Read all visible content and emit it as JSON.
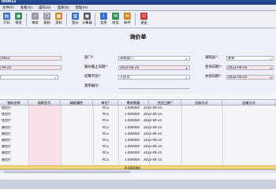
{
  "window": {
    "title": "000012"
  },
  "menu": [
    "文件(F)",
    "查看(V)",
    "操作(O)",
    "选择(S)",
    "帮助(H)"
  ],
  "toolbar": [
    {
      "label": "打印",
      "icon": "printer-icon",
      "color": "#3a6fc1",
      "glyph": "▤"
    },
    {
      "label": "预览",
      "icon": "preview-icon",
      "color": "#3a8f5a",
      "glyph": "◉"
    },
    {
      "label": "审核",
      "icon": "approve-icon",
      "color": "#9a9aa8",
      "glyph": "✓"
    },
    {
      "label": "复制",
      "icon": "copy-icon",
      "color": "#9a9aa8",
      "glyph": "❐"
    },
    {
      "label": "资料",
      "icon": "data-icon",
      "color": "#c98b2a",
      "glyph": "▦"
    },
    {
      "label": "图示",
      "icon": "chart-icon",
      "color": "#3a6fc1",
      "glyph": "▥"
    },
    {
      "label": "计算器",
      "icon": "calculator-icon",
      "color": "#555a6a",
      "glyph": "▣"
    },
    {
      "label": "信息",
      "icon": "info-icon",
      "color": "#3a6fc1",
      "glyph": "i"
    },
    {
      "label": "短信",
      "icon": "sms-icon",
      "color": "#3a8f5a",
      "glyph": "✉"
    },
    {
      "label": "邮件",
      "icon": "mail-icon",
      "color": "#c98b2a",
      "glyph": "✉"
    },
    {
      "label": "退出",
      "icon": "exit-icon",
      "color": "#c03a3a",
      "glyph": "⏻"
    }
  ],
  "form": {
    "title": "询价单",
    "left": {
      "field1": "0012",
      "field2": "04-25",
      "field3": ""
    },
    "dept_label": "部门*:",
    "dept_value": "采购部门",
    "quote_deadline_label": "报价截止日期*:",
    "quote_deadline_value": "2022-04-25",
    "currency_label": "结算币别*:",
    "currency_value": "人民币",
    "source_no_label": "源单编号:",
    "source_no_value": "",
    "buyer_label": "采购员*:",
    "buyer_value": "黄琴",
    "effective_label": "生效日期*:",
    "effective_value": "2022-04-25",
    "expire_label": "失效日期*:",
    "expire_value": "2022-05-25"
  },
  "grid": {
    "columns": [
      "物料名称",
      "规格型号",
      "辅助属性",
      "单位*",
      "需求数量",
      "交货日期*",
      "包装方式",
      "运输方式"
    ],
    "rows": [
      {
        "name": "钛铝片",
        "unit": "PCS",
        "qty": "1.000000",
        "date": "2022-04-25"
      },
      {
        "name": "钛铝片",
        "unit": "PCS",
        "qty": "1.000000",
        "date": "2022-04-25"
      },
      {
        "name": "钛铝片",
        "unit": "PCS",
        "qty": "1.000000",
        "date": "2022-04-25"
      },
      {
        "name": "黄铝片",
        "unit": "PCS",
        "qty": "1.000000",
        "date": "2022-04-25"
      },
      {
        "name": "黄铝片",
        "unit": "PCS",
        "qty": "1.000000",
        "date": "2022-04-25"
      },
      {
        "name": "黄铝片",
        "unit": "PCS",
        "qty": "1.000000",
        "date": "2022-04-25"
      },
      {
        "name": "黄铝片",
        "unit": "PCS",
        "qty": "1.000000",
        "date": "2022-04-25"
      },
      {
        "name": "黄铝片",
        "unit": "PCS",
        "qty": "1.000000",
        "date": "2022-04-25"
      },
      {
        "name": "黄铝片",
        "unit": "PCS",
        "qty": "1.000000",
        "date": "2022-04-25"
      }
    ],
    "total_qty": "9.000000"
  }
}
